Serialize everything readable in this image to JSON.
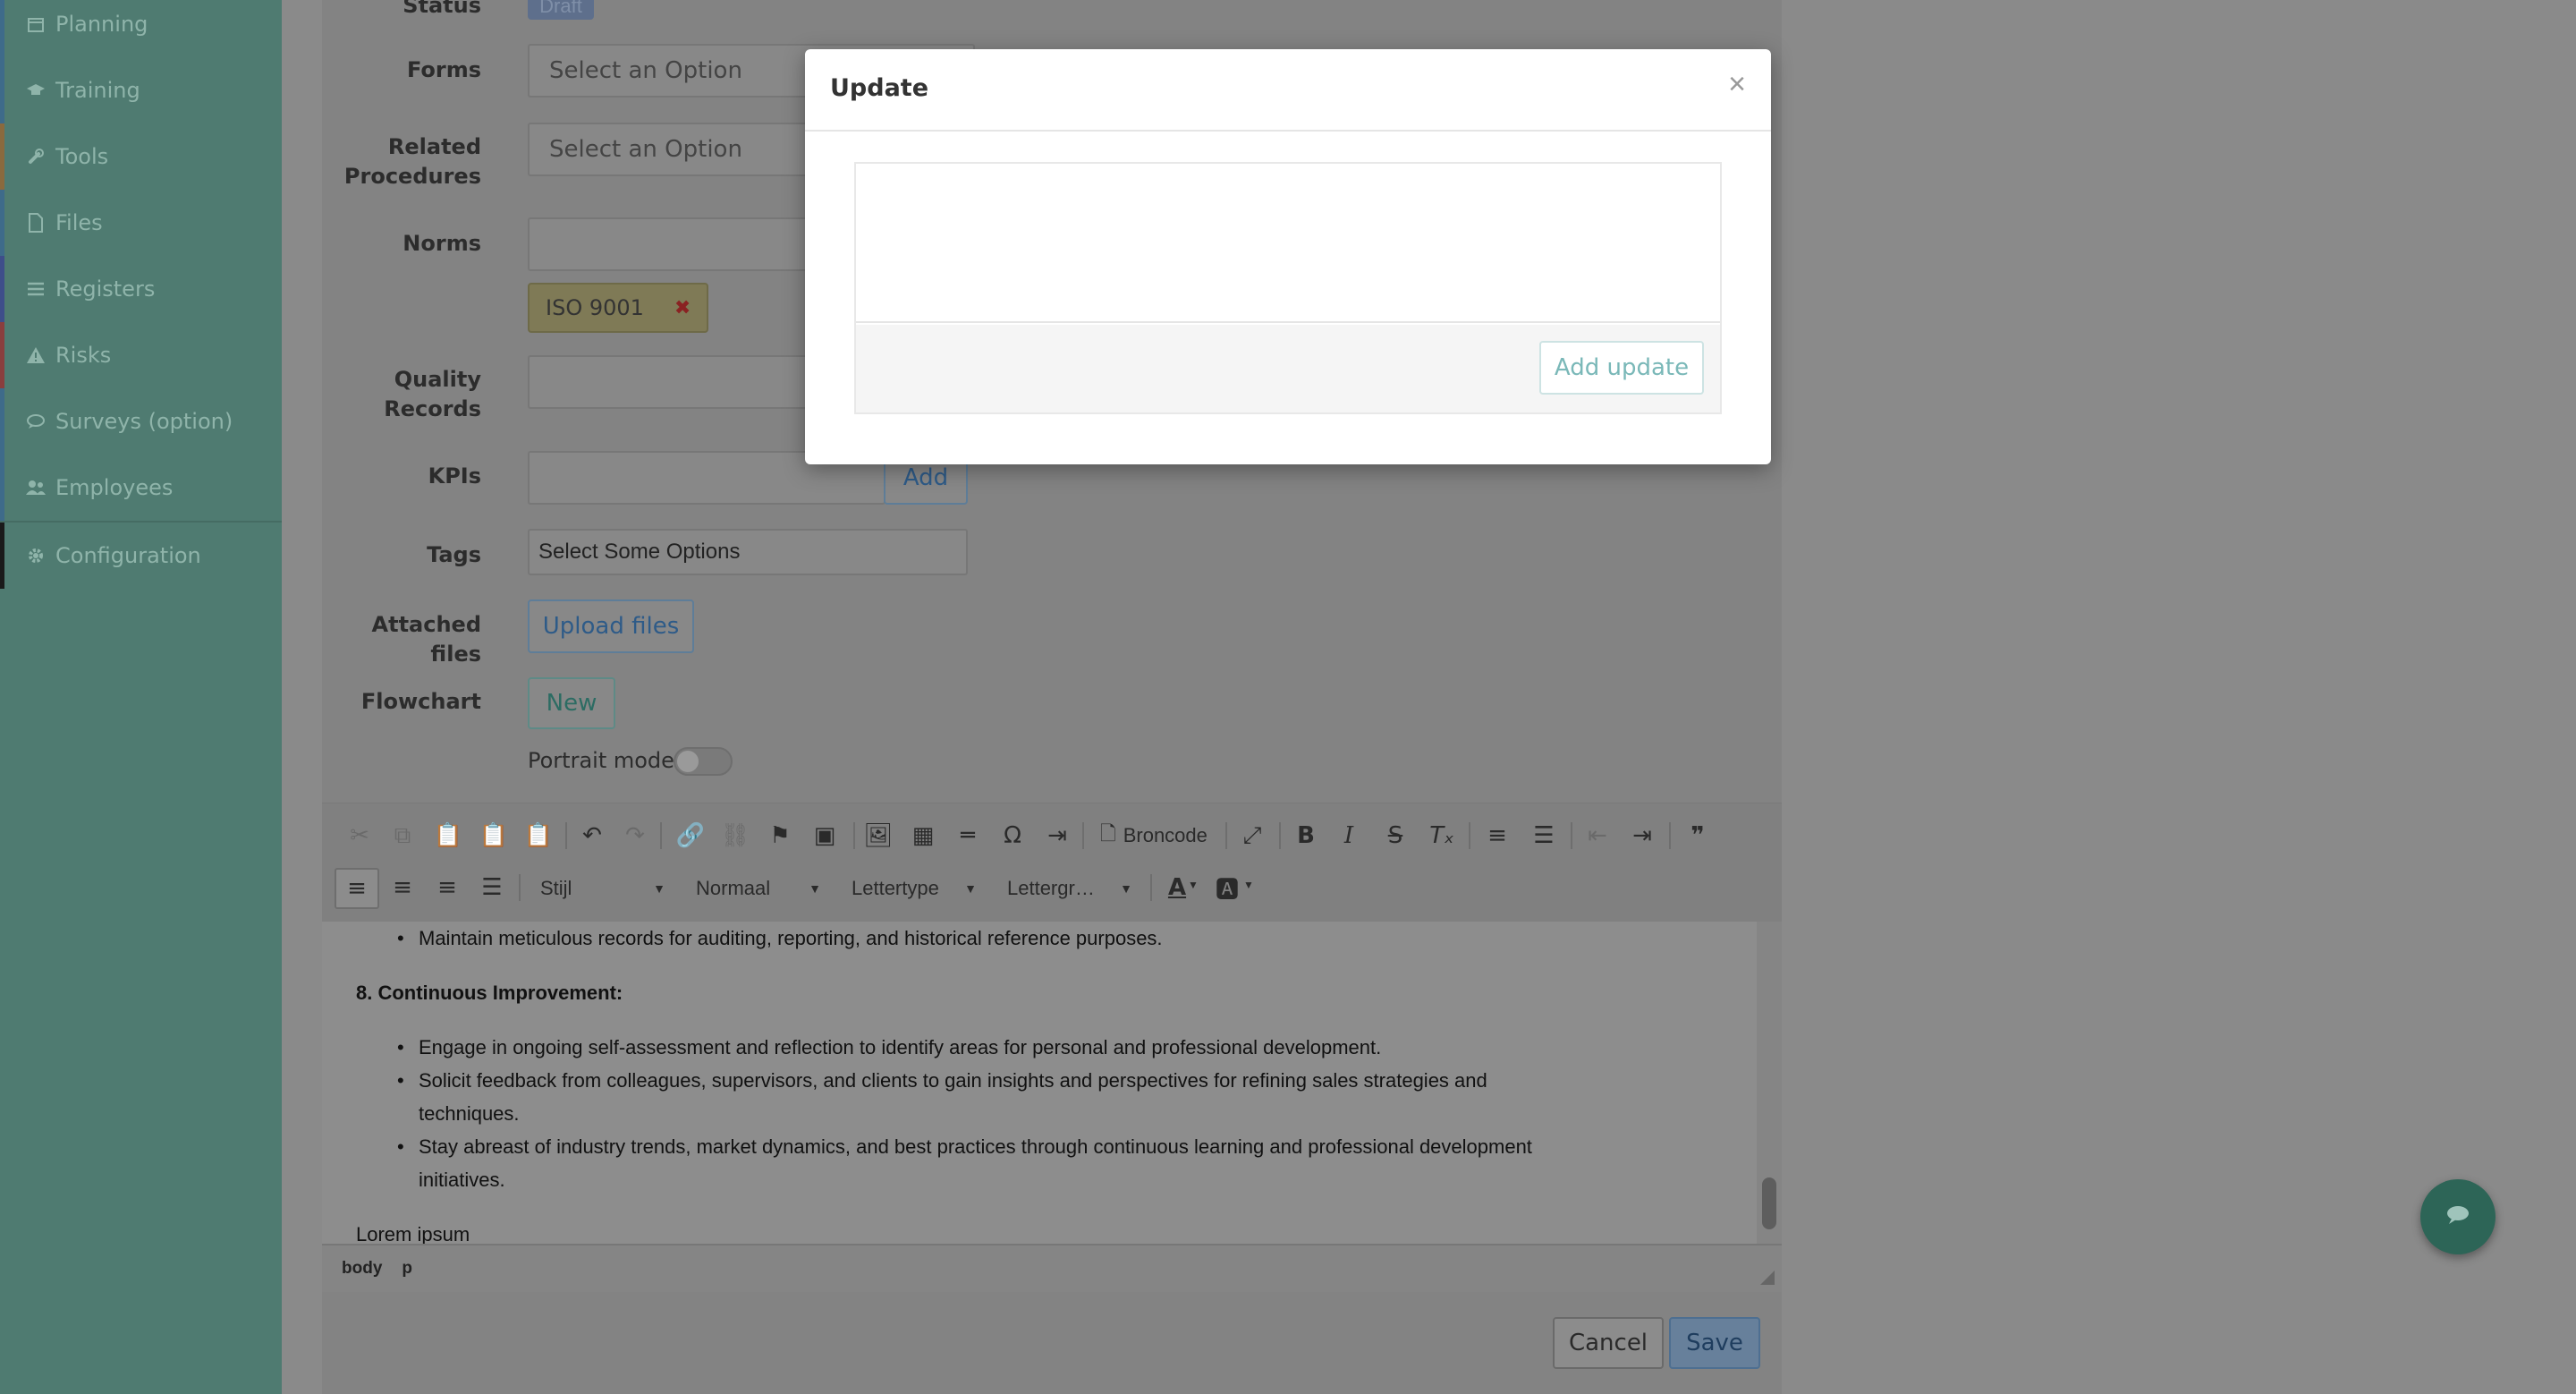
{
  "sidebar": {
    "items": [
      {
        "label": "Planning",
        "icon": "calendar-icon",
        "accent": "#3e6b8a"
      },
      {
        "label": "Training",
        "icon": "graduation-cap-icon",
        "accent": "#3e6b8a"
      },
      {
        "label": "Tools",
        "icon": "wrench-icon",
        "accent": "#8a6a3e"
      },
      {
        "label": "Files",
        "icon": "file-icon",
        "accent": "#3e6b8a"
      },
      {
        "label": "Registers",
        "icon": "list-icon",
        "accent": "#3e4e8a"
      },
      {
        "label": "Risks",
        "icon": "warning-icon",
        "accent": "#8a3e3e"
      },
      {
        "label": "Surveys (option)",
        "icon": "comments-icon",
        "accent": "#3e6b8a"
      },
      {
        "label": "Employees",
        "icon": "users-icon",
        "accent": "#3e6b8a"
      },
      {
        "label": "Configuration",
        "icon": "gear-icon",
        "accent": "#1a1a1a"
      }
    ]
  },
  "form": {
    "status_label": "Status",
    "status_value": "Draft",
    "forms_label": "Forms",
    "forms_placeholder": "Select an Option",
    "related_label_1": "Related",
    "related_label_2": "Procedures",
    "related_placeholder": "Select an Option",
    "norms_label": "Norms",
    "norm_tag": "ISO 9001",
    "quality_label_1": "Quality",
    "quality_label_2": "Records",
    "kpis_label": "KPIs",
    "kpis_add": "Add",
    "tags_label": "Tags",
    "tags_placeholder": "Select Some Options",
    "attached_label_1": "Attached",
    "attached_label_2": "files",
    "upload_button": "Upload files",
    "flowchart_label": "Flowchart",
    "flowchart_new": "New",
    "portrait_label": "Portrait mode:"
  },
  "editor": {
    "broncode": "Broncode",
    "style_dd": "Stijl",
    "format_dd": "Normaal",
    "font_dd": "Lettertype",
    "size_dd": "Lettergr…",
    "lines": {
      "b0": "Maintain meticulous records for auditing, reporting, and historical reference purposes.",
      "h8": "8. Continuous Improvement:",
      "b1": "Engage in ongoing self-assessment and reflection to identify areas for personal and professional development.",
      "b2a": "Solicit feedback from colleagues, supervisors, and clients to gain insights and perspectives for refining sales strategies and",
      "b2b": "techniques.",
      "b3a": "Stay abreast of industry trends, market dynamics, and best practices through continuous learning and professional development",
      "b3b": "initiatives.",
      "p": "Lorem ipsum"
    },
    "path": [
      "body",
      "p"
    ]
  },
  "actions": {
    "cancel": "Cancel",
    "save": "Save"
  },
  "modal": {
    "title": "Update",
    "close": "×",
    "add_button": "Add update"
  }
}
